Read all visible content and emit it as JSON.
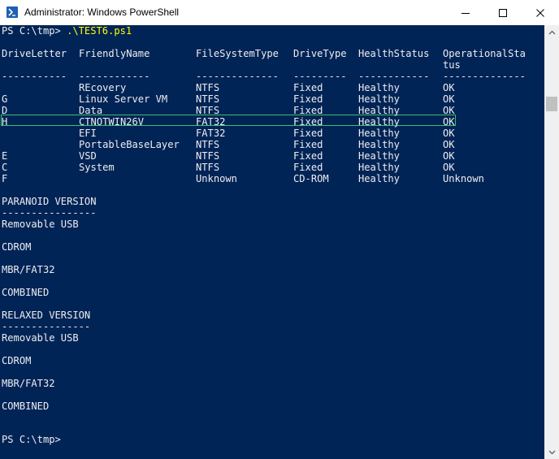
{
  "window": {
    "title": "Administrator: Windows PowerShell",
    "icon": "powershell-icon",
    "controls": [
      "minimize-icon",
      "maximize-icon",
      "close-icon"
    ]
  },
  "console": {
    "prompt_command": {
      "prompt": "PS C:\\tmp> ",
      "command": ".\\TEST6.ps1"
    },
    "table": {
      "headers": [
        "DriveLetter",
        "FriendlyName",
        "FileSystemType",
        "DriveType",
        "HealthStatus",
        "OperationalSta"
      ],
      "header_wrap": "tus",
      "separators": [
        "-----------",
        "------------",
        "--------------",
        "---------",
        "------------",
        "--------------"
      ],
      "rows": [
        [
          "",
          "REcovery",
          "NTFS",
          "Fixed",
          "Healthy",
          "OK"
        ],
        [
          "G",
          "Linux Server VM",
          "NTFS",
          "Fixed",
          "Healthy",
          "OK"
        ],
        [
          "D",
          "Data",
          "NTFS",
          "Fixed",
          "Healthy",
          "OK"
        ],
        [
          "H",
          "CTNOTWIN26V",
          "FAT32",
          "Fixed",
          "Healthy",
          "OK"
        ],
        [
          "",
          "EFI",
          "FAT32",
          "Fixed",
          "Healthy",
          "OK"
        ],
        [
          "",
          "PortableBaseLayer",
          "NTFS",
          "Fixed",
          "Healthy",
          "OK"
        ],
        [
          "E",
          "VSD",
          "NTFS",
          "Fixed",
          "Healthy",
          "OK"
        ],
        [
          "C",
          "System",
          "NTFS",
          "Fixed",
          "Healthy",
          "OK"
        ],
        [
          "F",
          "",
          "Unknown",
          "CD-ROM",
          "Healthy",
          "Unknown"
        ]
      ]
    },
    "paranoid": {
      "heading": "PARANOID VERSION",
      "underline": "----------------",
      "items": [
        "Removable USB",
        "CDROM",
        "MBR/FAT32",
        "COMBINED"
      ]
    },
    "relaxed": {
      "heading": "RELAXED VERSION",
      "underline": "---------------",
      "items": [
        "Removable USB",
        "CDROM",
        "MBR/FAT32",
        "COMBINED"
      ]
    },
    "final_prompt": "PS C:\\tmp>"
  },
  "colors": {
    "background": "#012456",
    "text": "#eeedf0",
    "command": "#ffff00",
    "selection": "#3fbf6a"
  }
}
